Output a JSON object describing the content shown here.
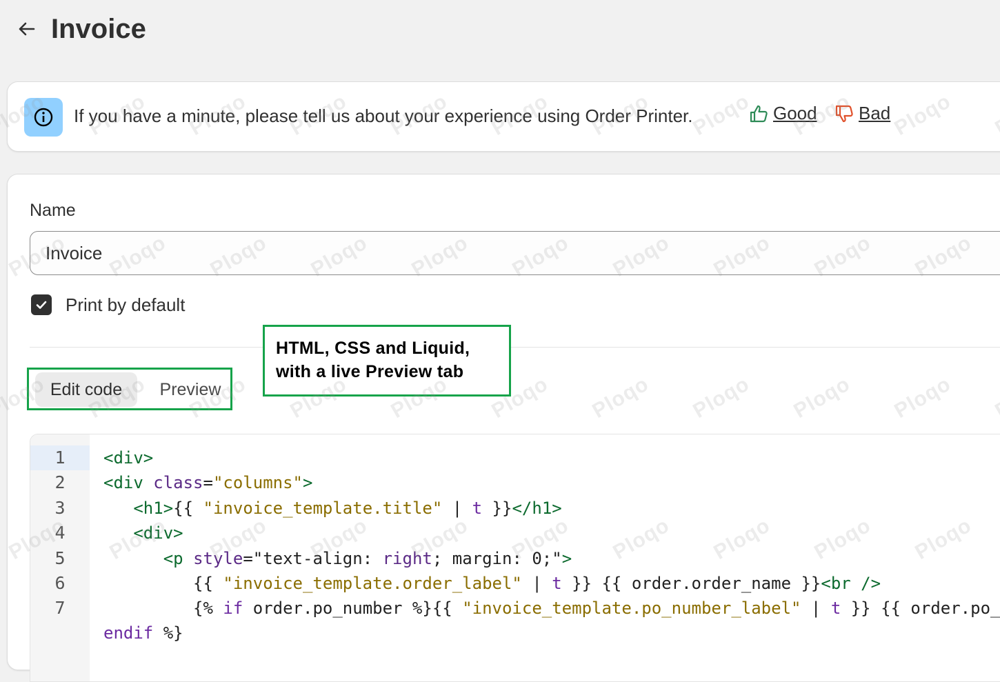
{
  "header": {
    "title": "Invoice"
  },
  "banner": {
    "text": "If you have a minute, please tell us about your experience using Order Printer.",
    "good_label": "Good",
    "bad_label": "Bad"
  },
  "form": {
    "name_label": "Name",
    "name_value": "Invoice",
    "print_default_label": "Print by default",
    "print_default_checked": true
  },
  "tabs": [
    {
      "label": "Edit code",
      "selected": true
    },
    {
      "label": "Preview",
      "selected": false
    }
  ],
  "callout": {
    "line1": "HTML, CSS and Liquid,",
    "line2": "with a live Preview tab"
  },
  "editor": {
    "active_line": 1,
    "line_numbers": [
      "1",
      "2",
      "3",
      "4",
      "5",
      "6",
      "7"
    ]
  },
  "watermark": "Ploqo",
  "colors": {
    "banner_icon_bg": "#91d0ff",
    "highlight_border": "#16a34a",
    "good_icon": "#2e8b57",
    "bad_icon": "#e0502a"
  }
}
